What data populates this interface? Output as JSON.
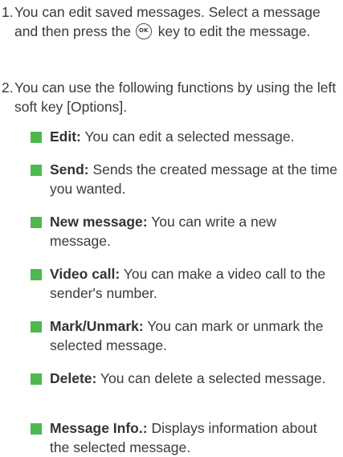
{
  "accent": "#4db84d",
  "steps": [
    {
      "num": "1.",
      "text_before_icon": "You can edit saved messages. Select a message and then press the",
      "icon": "ok-key-icon",
      "icon_label": "OK",
      "text_after_icon": "key to edit the message."
    },
    {
      "num": "2.",
      "text": "You can use the following functions by using the left soft key [Options]."
    }
  ],
  "bullets": [
    {
      "term": "Edit:",
      "desc": "You can edit a selected message."
    },
    {
      "term": "Send:",
      "desc": "Sends the created message at the time you wanted."
    },
    {
      "term": "New message:",
      "desc": "You can write a new message."
    },
    {
      "term": "Video call:",
      "desc": "You can make a video call to the sender's number."
    },
    {
      "term": "Mark/Unmark:",
      "desc": "You can mark or unmark the selected message."
    },
    {
      "term": "Delete:",
      "desc": "You can delete a selected message."
    },
    {
      "term": "Message Info.:",
      "desc": "Displays information about the selected message."
    }
  ]
}
